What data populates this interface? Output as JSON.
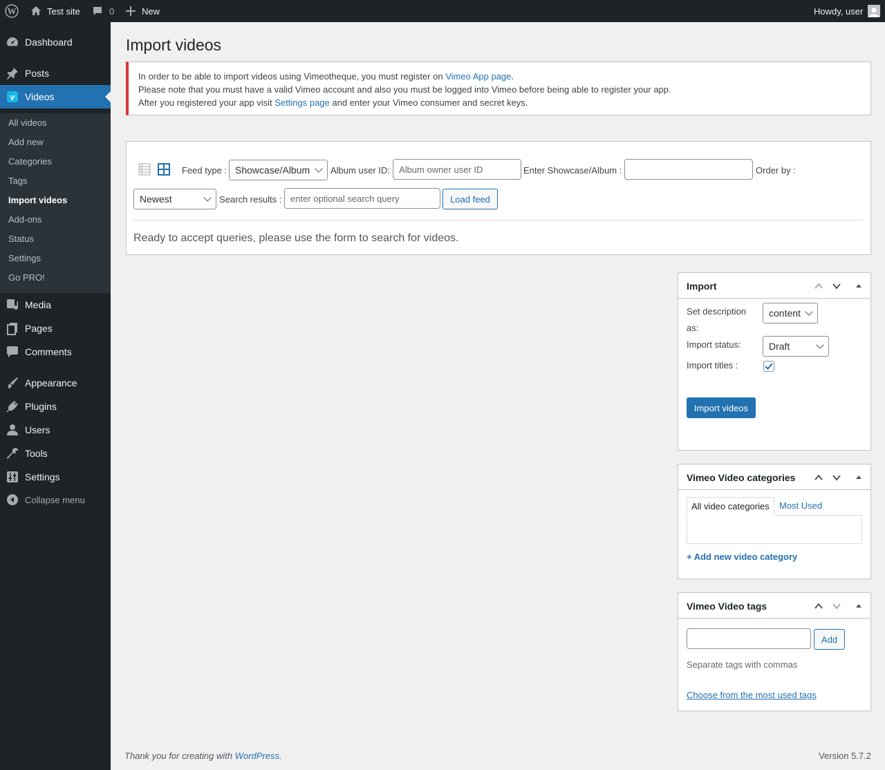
{
  "adminbar": {
    "site_name": "Test site",
    "comments_count": "0",
    "new_label": "New",
    "howdy": "Howdy, user"
  },
  "sidebar": {
    "items": [
      {
        "label": "Dashboard",
        "icon": "dashboard-icon"
      },
      {
        "label": "Posts",
        "icon": "pin-icon"
      },
      {
        "label": "Videos",
        "icon": "vimeo-icon"
      },
      {
        "label": "Media",
        "icon": "media-icon"
      },
      {
        "label": "Pages",
        "icon": "pages-icon"
      },
      {
        "label": "Comments",
        "icon": "comment-icon"
      },
      {
        "label": "Appearance",
        "icon": "brush-icon"
      },
      {
        "label": "Plugins",
        "icon": "plugin-icon"
      },
      {
        "label": "Users",
        "icon": "users-icon"
      },
      {
        "label": "Tools",
        "icon": "wrench-icon"
      },
      {
        "label": "Settings",
        "icon": "settings-icon"
      },
      {
        "label": "Collapse menu",
        "icon": "collapse-icon"
      }
    ],
    "submenu": [
      "All videos",
      "Add new",
      "Categories",
      "Tags",
      "Import videos",
      "Add-ons",
      "Status",
      "Settings",
      "Go PRO!"
    ]
  },
  "page": {
    "title": "Import videos",
    "notice": {
      "line1_pre": "In order to be able to import videos using Vimeotheque, you must register on ",
      "line1_link": "Vimeo App page",
      "line1_post": ".",
      "line2": "Please note that you must have a valid Vimeo account and also you must be logged into Vimeo before being able to register your app.",
      "line3_pre": "After you registered your app visit ",
      "line3_link": "Settings page",
      "line3_post": " and enter your Vimeo consumer and secret keys."
    },
    "form": {
      "feed_type_label": "Feed type :",
      "feed_type_value": "Showcase/Album",
      "album_user_label": "Album user ID:",
      "album_user_placeholder": "Album owner user ID",
      "showcase_label": "Enter Showcase/Album :",
      "showcase_value": "",
      "order_by_label": "Order by :",
      "order_by_value": "Newest",
      "search_label": "Search results :",
      "search_placeholder": "enter optional search query",
      "load_button": "Load feed",
      "status_text": "Ready to accept queries, please use the form to search for videos."
    },
    "import_box": {
      "title": "Import",
      "desc_label_1": "Set description",
      "desc_label_2": "as:",
      "desc_value": "content",
      "status_label": "Import status:",
      "status_value": "Draft",
      "titles_label": "Import titles :",
      "titles_checked": true,
      "import_button": "Import videos"
    },
    "categories_box": {
      "title": "Vimeo Video categories",
      "tab_all": "All video categories",
      "tab_most_used": "Most Used",
      "add_link": "+ Add new video category"
    },
    "tags_box": {
      "title": "Vimeo Video tags",
      "add_button": "Add",
      "hint": "Separate tags with commas",
      "choose_link": "Choose from the most used tags"
    }
  },
  "footer": {
    "thanks_pre": "Thank you for creating with ",
    "thanks_link": "WordPress",
    "thanks_post": ".",
    "version": "Version 5.7.2"
  },
  "colors": {
    "accent": "#2271b1",
    "adminbar_bg": "#1d2327",
    "notice_error": "#d63638"
  }
}
